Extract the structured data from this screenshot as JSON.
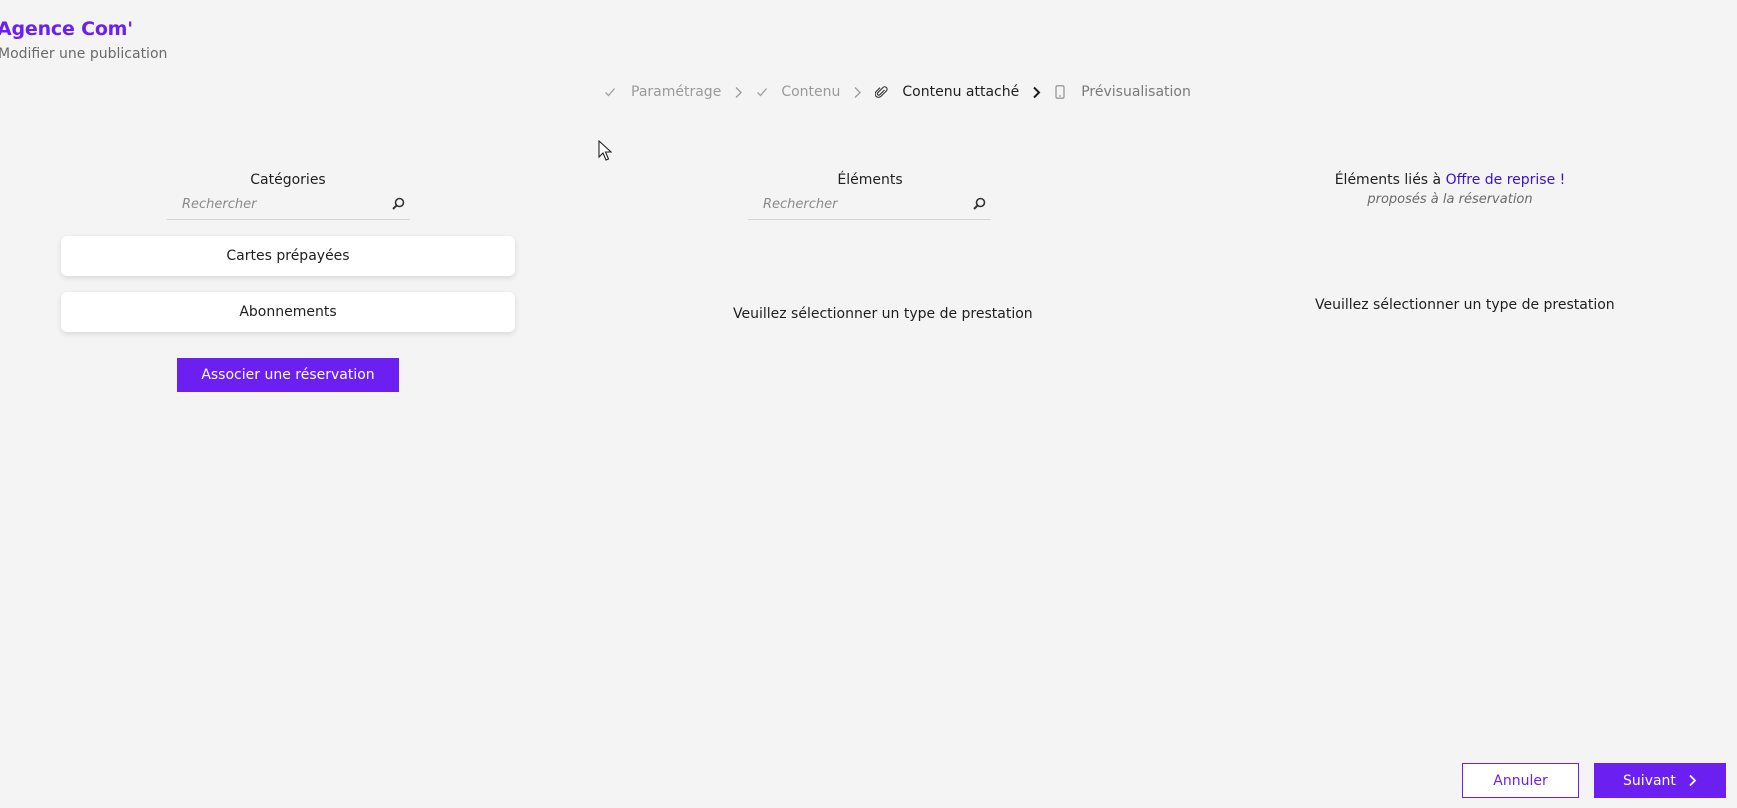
{
  "header": {
    "app_title": "Agence Com'",
    "subtitle": "Modifier une publication"
  },
  "stepper": {
    "steps": [
      {
        "label": "Paramétrage",
        "icon": "check-icon",
        "state": "done"
      },
      {
        "label": "Contenu",
        "icon": "check-icon",
        "state": "done"
      },
      {
        "label": "Contenu attaché",
        "icon": "paperclip-icon",
        "state": "active"
      },
      {
        "label": "Prévisualisation",
        "icon": "mobile-icon",
        "state": "pending"
      }
    ]
  },
  "categories": {
    "title": "Catégories",
    "search_placeholder": "Rechercher",
    "items": [
      {
        "label": "Cartes prépayées"
      },
      {
        "label": "Abonnements"
      }
    ],
    "associate_button": "Associer une réservation"
  },
  "elements": {
    "title": "Éléments",
    "search_placeholder": "Rechercher",
    "empty_message": "Veuillez sélectionner un type de prestation"
  },
  "linked": {
    "title_prefix": "Éléments liés à ",
    "title_highlight": "Offre de reprise !",
    "subtitle": "proposés à la réservation",
    "empty_message": "Veuillez sélectionner un type de prestation"
  },
  "footer": {
    "cancel_label": "Annuler",
    "next_label": "Suivant"
  },
  "colors": {
    "accent": "#6b1ff0",
    "background": "#f4f4f4",
    "link": "#3c0fd0"
  }
}
